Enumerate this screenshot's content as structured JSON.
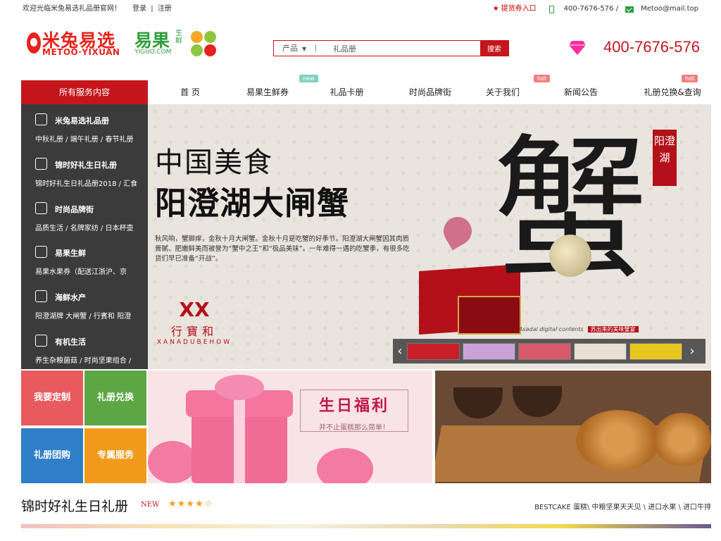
{
  "topbar": {
    "welcome": "欢迎光临米兔易选礼品册官网！",
    "login": "登录",
    "divider": "|",
    "register": "注册",
    "pickup": "提货券入口",
    "phone": "400-7676-576 /",
    "email": "Metoo@mail.top"
  },
  "logos": {
    "metoo_cn": "米兔易选",
    "metoo_en": "METOO·YIXUAN",
    "yiguo_cn": "易果",
    "yiguo_sub": "生鲜",
    "yiguo_en": "YIGUO.COM"
  },
  "search": {
    "category": "产品",
    "value": "礼品册",
    "button": "搜索"
  },
  "hotline": "400-7676-576",
  "nav": {
    "all_services": "所有服务内容",
    "items": [
      {
        "label": "首 页",
        "badge": ""
      },
      {
        "label": "易果生鲜券",
        "badge": "new"
      },
      {
        "label": "礼品卡册",
        "badge": ""
      },
      {
        "label": "时尚品牌街",
        "badge": ""
      },
      {
        "label": "关于我们",
        "badge": "hot"
      },
      {
        "label": "新闻公告",
        "badge": ""
      },
      {
        "label": "礼册兑换&查询",
        "badge": "hot"
      }
    ]
  },
  "sidebar": [
    {
      "title": "米兔易选礼品册",
      "links": "中秋礼册 / 端午礼册 / 春节礼册"
    },
    {
      "title": "锦时好礼生日礼册",
      "links": "锦时好礼生日礼品册2018 / 汇食"
    },
    {
      "title": "时尚品牌街",
      "links": "品质生活 / 名牌家纺 / 日本杯壶"
    },
    {
      "title": "易果生鲜",
      "links": "易果水果券（配送江浙沪、京"
    },
    {
      "title": "海鲜水产",
      "links": "阳澄湖牌 大闸蟹 / 行賓和 阳澄"
    },
    {
      "title": "有机生活",
      "links": "养生杂粮菌菇 / 时尚坚果组合 /"
    }
  ],
  "banner": {
    "heading1": "中国美食",
    "heading2": "阳澄湖大闸蟹",
    "para": "秋风响，蟹脚痒，金秋十月大闸蟹。金秋十月是吃蟹的好季节。阳澄湖大闸蟹因其肉质膏腻、肥嫩鲜美而被誉为“蟹中之王”和“极品美味”。一年难得一遇的吃蟹季，有很多吃货们早已准备“开战”。",
    "big_char": "蟹",
    "seal": "阳澄湖",
    "brand_mark": "XX",
    "brand_cn": "行寶和",
    "brand_en": "XANADUBEHOW",
    "caption": "Asadal digital contents",
    "caption_tag": "苏出来的美味蟹宴",
    "prev": "‹",
    "next": "›"
  },
  "tiles": [
    {
      "label": "我要定制",
      "color": "#e85a5e"
    },
    {
      "label": "礼册兑换",
      "color": "#5ca744"
    },
    {
      "label": "礼册团购",
      "color": "#2f7ec8"
    },
    {
      "label": "专属服务",
      "color": "#f29a1c"
    }
  ],
  "promo_birthday": {
    "title": "生日福利",
    "sub": "并不止蛋糕那么简单！"
  },
  "section": {
    "title": "锦时好礼生日礼册",
    "new": "NEW",
    "stars": "★★★★☆",
    "links": "BESTCAKE 蛋糕\\ 中粮坚果天天见 \\ 进口水果 \\ 进口牛排"
  },
  "colors": {
    "brand_red": "#c4161c",
    "yiguo_green": "#2e9e3a",
    "sidebar_bg": "#3b3b3b"
  }
}
